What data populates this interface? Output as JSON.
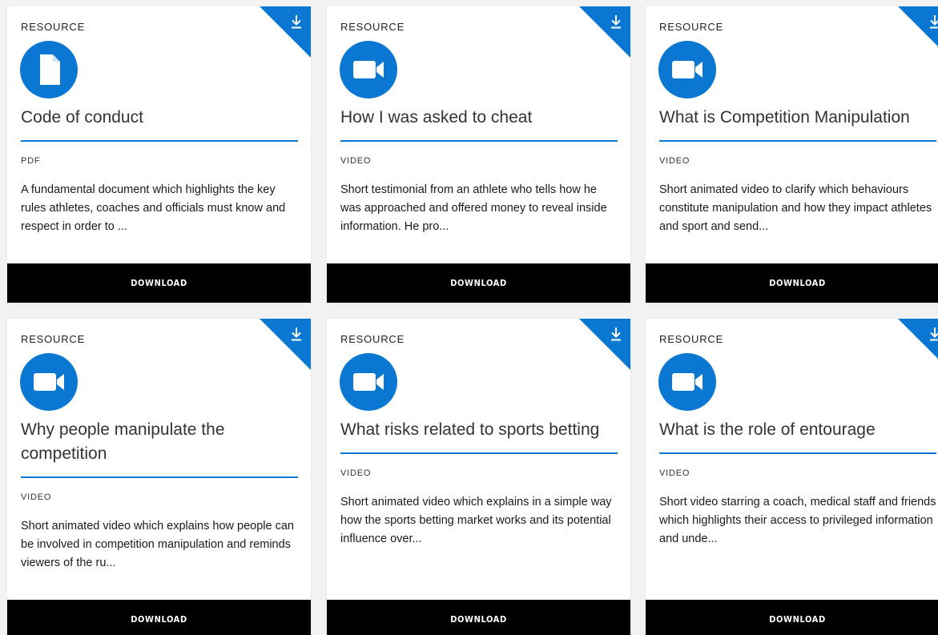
{
  "colors": {
    "accent": "#0a78d2",
    "button_bg": "#000000",
    "button_text": "#ffffff"
  },
  "cards": [
    {
      "category": "RESOURCE",
      "icon": "document-icon",
      "title": "Code of conduct",
      "format": "PDF",
      "description": "A fundamental document which highlights the key rules athletes, coaches and officials must know and respect in order to ...",
      "button_label": "DOWNLOAD"
    },
    {
      "category": "RESOURCE",
      "icon": "video-camera-icon",
      "title": "How I was asked to cheat",
      "format": "VIDEO",
      "description": "Short testimonial from an athlete who tells how he was approached and offered money to reveal inside information. He pro...",
      "button_label": "DOWNLOAD"
    },
    {
      "category": "RESOURCE",
      "icon": "video-camera-icon",
      "title": "What is Competition Manipulation",
      "format": "VIDEO",
      "description": "Short animated video to clarify which behaviours constitute manipulation and how they impact athletes and sport and send...",
      "button_label": "DOWNLOAD"
    },
    {
      "category": "RESOURCE",
      "icon": "video-camera-icon",
      "title": "Why people manipulate the competition",
      "format": "VIDEO",
      "description": "Short animated video which explains how people can be involved in competition manipulation and reminds viewers of the ru...",
      "button_label": "DOWNLOAD"
    },
    {
      "category": "RESOURCE",
      "icon": "video-camera-icon",
      "title": "What risks related to sports betting",
      "format": "VIDEO",
      "description": "Short animated video which explains in a simple way how the sports betting market works and its potential influence over...",
      "button_label": "DOWNLOAD"
    },
    {
      "category": "RESOURCE",
      "icon": "video-camera-icon",
      "title": "What is the role of entourage",
      "format": "VIDEO",
      "description": "Short video starring a coach, medical staff and friends which highlights their access to privileged information and unde...",
      "button_label": "DOWNLOAD"
    }
  ]
}
